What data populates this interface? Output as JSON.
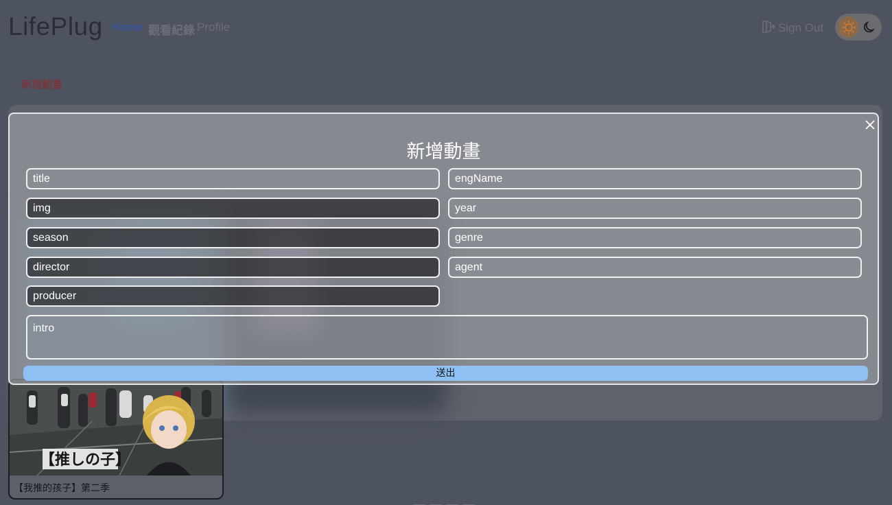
{
  "nav": {
    "brand": "LifePlug",
    "home": "Home",
    "history": "觀看紀錄",
    "profile": "Profile",
    "sign_out": "Sign Out"
  },
  "page": {
    "add_anime_link": "新增動畫",
    "card_title": "【我推的孩子】第二季",
    "card_image_caption": "【推しの子】"
  },
  "modal": {
    "title": "新增動畫",
    "fields": {
      "title": "title",
      "engName": "engName",
      "img": "img",
      "year": "year",
      "season": "season",
      "genre": "genre",
      "director": "director",
      "agent": "agent",
      "producer": "producer",
      "intro": "intro"
    },
    "submit": "送出"
  },
  "colors": {
    "accent": "#8fc1f5",
    "home_link": "#2f4fae",
    "add_link": "#8a2b2f"
  }
}
